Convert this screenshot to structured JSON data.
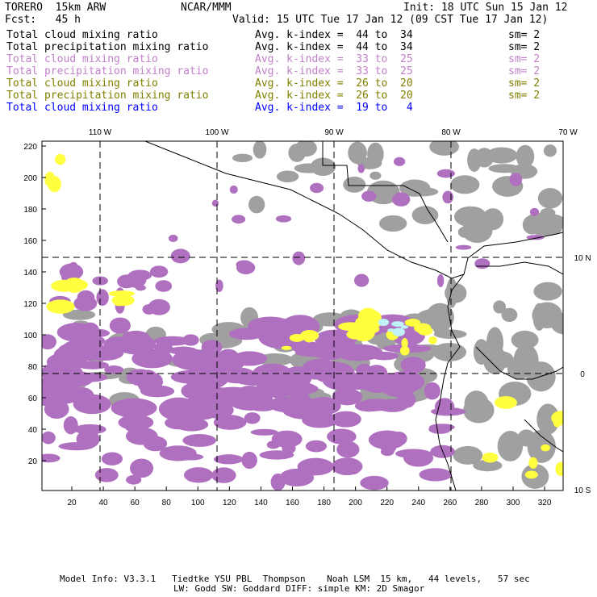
{
  "header": {
    "model": "TORERO  15km ARW",
    "org": "NCAR/MMM",
    "init": "Init: 18 UTC Sun 15 Jan 12",
    "fcst": "Fcst:   45 h",
    "valid": "Valid: 15 UTC Tue 17 Jan 12 (09 CST Tue 17 Jan 12)"
  },
  "fields": [
    {
      "name": "Total cloud mixing ratio",
      "range": "Avg. k-index =  44 to  34",
      "sm": "sm= 2",
      "color": "#000000"
    },
    {
      "name": "Total precipitation mixing ratio",
      "range": "Avg. k-index =  44 to  34",
      "sm": "sm= 2",
      "color": "#000000"
    },
    {
      "name": "Total cloud mixing ratio",
      "range": "Avg. k-index =  33 to  25",
      "sm": "sm= 2",
      "color": "#c080c8"
    },
    {
      "name": "Total precipitation mixing ratio",
      "range": "Avg. k-index =  33 to  25",
      "sm": "sm= 2",
      "color": "#c080c8"
    },
    {
      "name": "Total cloud mixing ratio",
      "range": "Avg. k-index =  26 to  20",
      "sm": "sm= 2",
      "color": "#808000"
    },
    {
      "name": "Total precipitation mixing ratio",
      "range": "Avg. k-index =  26 to  20",
      "sm": "sm= 2",
      "color": "#808000"
    },
    {
      "name": "Total cloud mixing ratio",
      "range": "Avg. k-index =  19 to   4",
      "sm": "",
      "color": "#0000ff"
    }
  ],
  "map": {
    "lon_labels": [
      "110 W",
      "100 W",
      "90 W",
      "80 W",
      "70 W"
    ],
    "lat_labels": [
      "10 N",
      "0",
      "10 S"
    ],
    "y_ticks": [
      "220",
      "200",
      "180",
      "160",
      "140",
      "120",
      "100",
      "80",
      "60",
      "40",
      "20"
    ],
    "x_ticks": [
      "20",
      "40",
      "60",
      "80",
      "100",
      "120",
      "140",
      "160",
      "180",
      "200",
      "220",
      "240",
      "260",
      "280",
      "300",
      "320"
    ],
    "colors": {
      "gray": "#a0a0a0",
      "purple": "#b070c0",
      "yellow": "#ffff40",
      "cyan": "#c0f0f8"
    }
  },
  "footer": {
    "line1": "Model Info: V3.3.1   Tiedtke YSU PBL  Thompson    Noah LSM  15 km,   44 levels,   57 sec",
    "line2": "LW: Godd SW: Goddard DIFF: simple KM: 2D Smagor"
  }
}
